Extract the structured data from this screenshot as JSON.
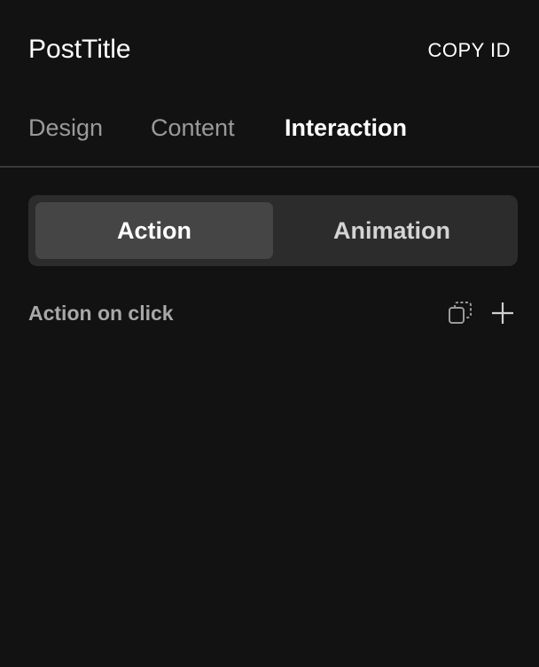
{
  "header": {
    "title": "PostTitle",
    "copy_id_label": "COPY ID"
  },
  "tabs": [
    {
      "label": "Design",
      "active": false
    },
    {
      "label": "Content",
      "active": false
    },
    {
      "label": "Interaction",
      "active": true
    }
  ],
  "segmented": {
    "options": [
      {
        "label": "Action",
        "selected": true
      },
      {
        "label": "Animation",
        "selected": false
      }
    ]
  },
  "section": {
    "label": "Action on click",
    "icons": [
      "duplicate-icon",
      "plus-icon"
    ]
  },
  "colors": {
    "background": "#121212",
    "segment_track": "#2c2c2c",
    "segment_selected": "#454545",
    "muted_text": "#9a9a9a",
    "divider": "#3a3a3a"
  }
}
